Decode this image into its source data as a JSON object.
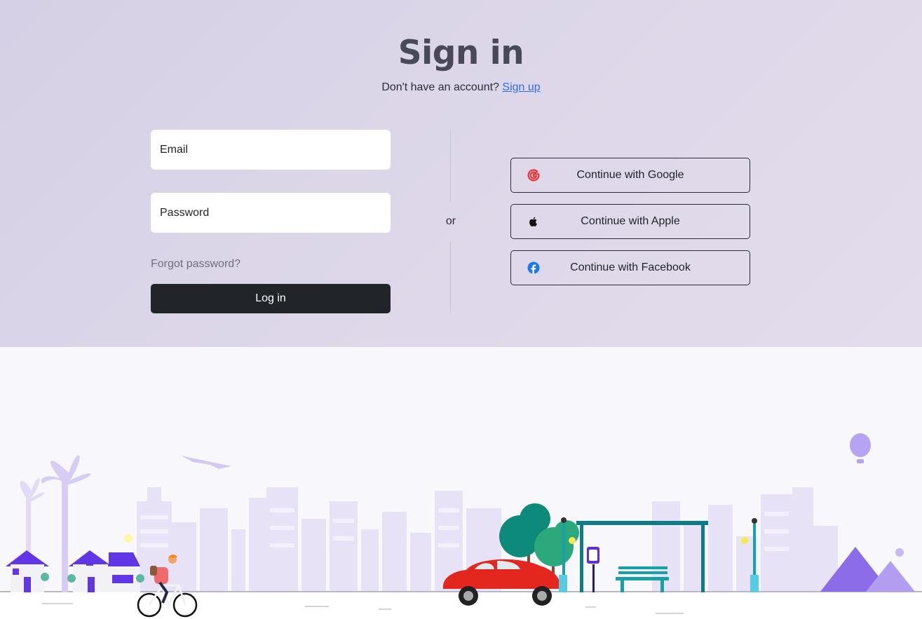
{
  "page": {
    "title": "Sign in",
    "subtitle": "Don't have an account?",
    "signup_link": "Sign up"
  },
  "form": {
    "email_placeholder": "Email",
    "password_placeholder": "Password",
    "forgot_password": "Forgot password?",
    "login_button": "Log in"
  },
  "divider": {
    "label": "or"
  },
  "social": {
    "google": {
      "label": "Continue with Google",
      "icon": "google-icon",
      "color": "#e5383b"
    },
    "apple": {
      "label": "Continue with Apple",
      "icon": "apple-icon",
      "color": "#111111"
    },
    "facebook": {
      "label": "Continue with Facebook",
      "icon": "facebook-icon",
      "color": "#1877f2"
    }
  },
  "colors": {
    "hero_bg": "#dad4e8",
    "primary_button": "#212529",
    "link": "#2f6ee6",
    "illustration_accent": "#6c4ae6"
  }
}
